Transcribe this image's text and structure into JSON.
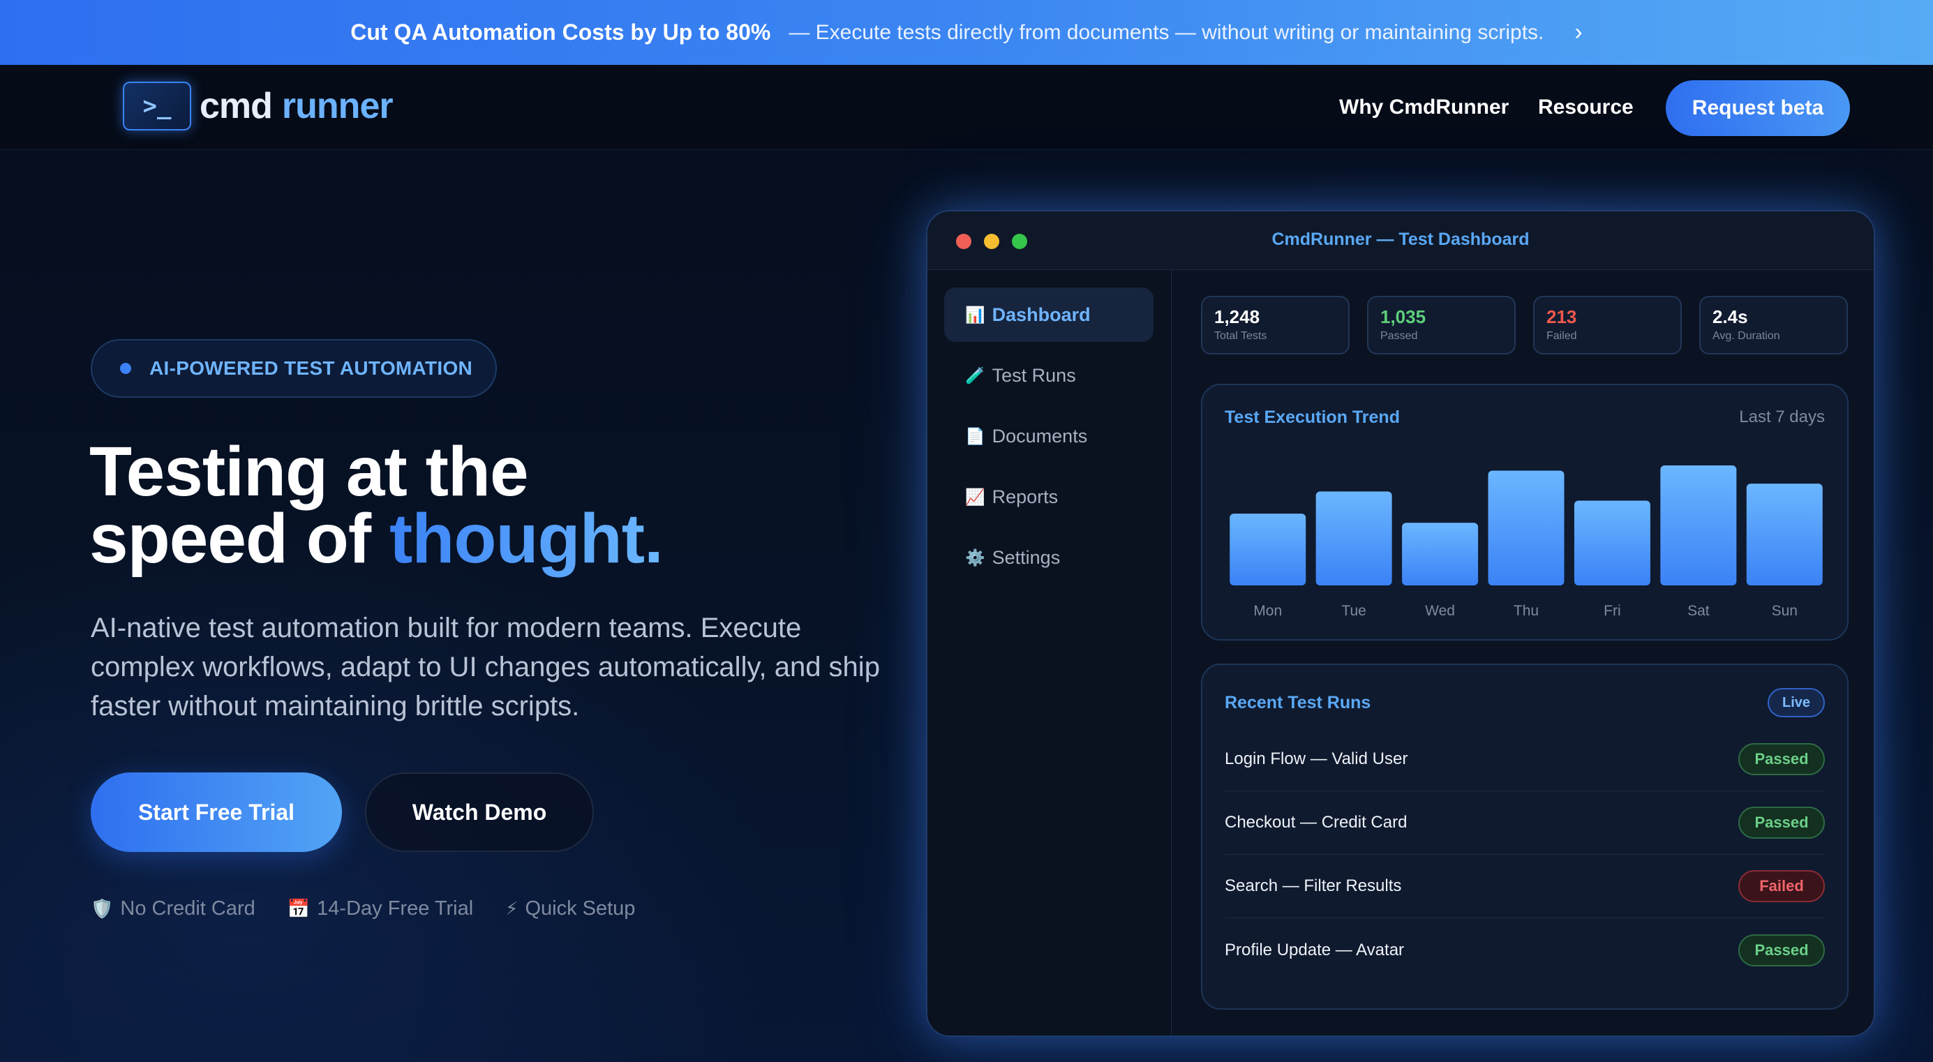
{
  "banner": {
    "headline": "Cut QA Automation Costs by Up to 80%",
    "text": "— Execute tests directly from documents — without writing or maintaining scripts.",
    "chevron": "›",
    "color_start": "#2e6ff0",
    "color_end": "#56abf5"
  },
  "nav": {
    "logo_symbol": ">_",
    "logo_word1": "cmd",
    "logo_word2": "runner",
    "links": [
      "Why CmdRunner",
      "Resource"
    ],
    "cta": "Request beta"
  },
  "hero": {
    "badge": "AI-POWERED TEST AUTOMATION",
    "title_line1": "Testing at the",
    "title_line2_plain": "speed of ",
    "title_line2_accent": "thought.",
    "subtitle": "AI-native test automation built for modern teams. Execute complex workflows, adapt to UI changes automatically, and ship faster without maintaining brittle scripts.",
    "primary_cta": "Start Free Trial",
    "secondary_cta": "Watch Demo",
    "perks": [
      {
        "icon": "🛡️",
        "icon_name": "shield-icon",
        "label": "No Credit Card"
      },
      {
        "icon": "📅",
        "icon_name": "calendar-icon",
        "label": "14-Day Free Trial"
      },
      {
        "icon": "⚡",
        "icon_name": "lightning-icon",
        "label": "Quick Setup"
      }
    ],
    "accent_color": "#3b82f6"
  },
  "dashboard": {
    "window_title": "CmdRunner — Test Dashboard",
    "sidebar": [
      {
        "icon": "📊",
        "icon_name": "bar-chart-icon",
        "label": "Dashboard",
        "active": true
      },
      {
        "icon": "🧪",
        "icon_name": "test-tube-icon",
        "label": "Test Runs",
        "active": false
      },
      {
        "icon": "📄",
        "icon_name": "document-icon",
        "label": "Documents",
        "active": false
      },
      {
        "icon": "📈",
        "icon_name": "trend-chart-icon",
        "label": "Reports",
        "active": false
      },
      {
        "icon": "⚙️",
        "icon_name": "gear-icon",
        "label": "Settings",
        "active": false
      }
    ],
    "stats": [
      {
        "value": "1,248",
        "label": "Total Tests",
        "tone": "default"
      },
      {
        "value": "1,035",
        "label": "Passed",
        "tone": "green"
      },
      {
        "value": "213",
        "label": "Failed",
        "tone": "red"
      },
      {
        "value": "2.4s",
        "label": "Avg. Duration",
        "tone": "default"
      }
    ],
    "trend": {
      "title": "Test Execution Trend",
      "range": "Last 7 days"
    },
    "recent": {
      "title": "Recent Test Runs",
      "live": "Live",
      "runs": [
        {
          "name": "Login Flow — Valid User",
          "status": "Passed"
        },
        {
          "name": "Checkout — Credit Card",
          "status": "Passed"
        },
        {
          "name": "Search — Filter Results",
          "status": "Failed"
        },
        {
          "name": "Profile Update — Avatar",
          "status": "Passed"
        }
      ]
    },
    "colors": {
      "pass": "#6bd088",
      "fail": "#f0646a",
      "bar_top": "#6bb6ff",
      "bar_bottom": "#3b82f6"
    }
  },
  "chart_data": {
    "type": "bar",
    "title": "Test Execution Trend",
    "categories": [
      "Mon",
      "Tue",
      "Wed",
      "Thu",
      "Fri",
      "Sat",
      "Sun"
    ],
    "values": [
      55,
      72,
      48,
      88,
      65,
      92,
      78
    ],
    "ylim": [
      0,
      100
    ],
    "grid": false,
    "xlabel": "",
    "ylabel": ""
  }
}
